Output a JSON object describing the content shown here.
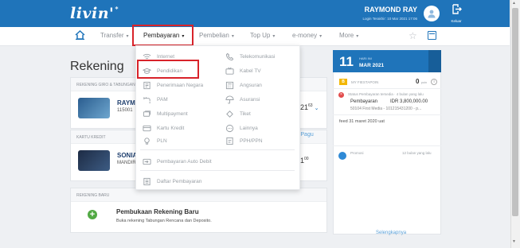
{
  "header": {
    "logo": "livin'",
    "logo_mark": "*",
    "user_name": "RAYMOND RAY",
    "last_login": "Login Terakhir: 10 Mar 2021 17:06",
    "logout_label": "Keluar"
  },
  "nav": {
    "transfer": "Transfer",
    "pembayaran": "Pembayaran",
    "pembelian": "Pembelian",
    "topup": "Top Up",
    "emoney": "e-money",
    "more": "More",
    "caret": "▾"
  },
  "main": {
    "title": "Rekening",
    "section_giro": "REKENING GIRO & TABUNGAN",
    "acct1_name": "RAYMO",
    "acct1_number": "115001",
    "acct1_balance": "21",
    "acct1_balance_sup": "63",
    "section_kartu": "KARTU KREDIT",
    "acct2_name": "SONIA",
    "acct2_sub": "MANDIR",
    "acct2_balance": "1",
    "acct2_balance_sup": "00",
    "pagu_label": "al Pagu",
    "section_baru": "REKENING BARU",
    "new_title": "Pembukaan Rekening Baru",
    "new_sub": "Buka rekening Tabungan Rencana dan Deposito."
  },
  "dropdown": {
    "col1": [
      "Internet",
      "Pendidikan",
      "Penerimaan Negara",
      "PAM",
      "Multipayment",
      "Kartu Kredit",
      "PLN"
    ],
    "col2": [
      "Telekomunikasi",
      "Kabel TV",
      "Angsuran",
      "Asuransi",
      "Tiket",
      "Lainnya",
      "PPH/PPN"
    ],
    "auto_debit": "Pembayaran Auto Debit",
    "daftar": "Daftar Pembayaran",
    "icons_col1": [
      "wifi-icon",
      "graduation-cap-icon",
      "government-document-icon",
      "water-tap-icon",
      "multipayment-card-icon",
      "credit-card-icon",
      "lightbulb-icon"
    ],
    "icons_col2": [
      "phone-icon",
      "tv-icon",
      "calculator-icon",
      "umbrella-icon",
      "ticket-icon",
      "more-dots-icon",
      "tax-document-icon"
    ]
  },
  "right_panel": {
    "day": "11",
    "hari_ini": "HARI INI",
    "month": "MAR 2021",
    "badge": "B",
    "points_label": "MY FIESTAPOIN",
    "points_value": "0",
    "points_unit": "poin",
    "notif_meta": "Status Pembayaran tersedia · 4 bulan yang lalu",
    "notif_title": "Pembayaran",
    "notif_amount": "IDR 3,800,000.00",
    "notif_detail": "50104 First Media - 101215431200 - p...",
    "feed": "feed 31 maret 2020 uat",
    "promo_label": "Promosi",
    "promo_time": "12 bulan yang lalu",
    "see_more": "Selengkapnya"
  },
  "colors": {
    "brand_blue": "#1f74ba",
    "highlight_red": "#d8232a",
    "success_green": "#52a944"
  }
}
